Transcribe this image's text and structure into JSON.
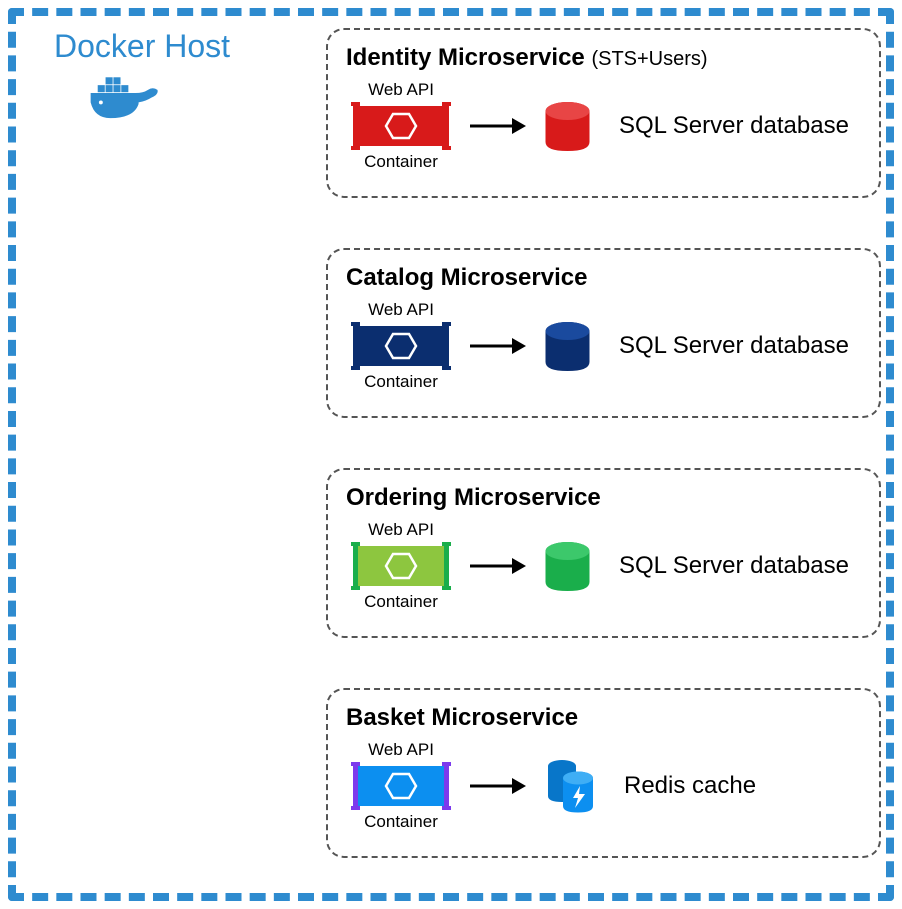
{
  "host_title": "Docker Host",
  "services": [
    {
      "title": "Identity Microservice",
      "subtitle": "(STS+Users)",
      "web_api": "Web API",
      "container": "Container",
      "db_label": "SQL Server database",
      "color_fill": "#d81a1a",
      "color_stroke": "#d81a1a",
      "db_type": "sql"
    },
    {
      "title": "Catalog Microservice",
      "subtitle": "",
      "web_api": "Web API",
      "container": "Container",
      "db_label": "SQL Server database",
      "color_fill": "#0b2e6f",
      "color_stroke": "#0b2e6f",
      "db_type": "sql"
    },
    {
      "title": "Ordering Microservice",
      "subtitle": "",
      "web_api": "Web API",
      "container": "Container",
      "db_label": "SQL Server database",
      "color_fill": "#8dc63f",
      "color_stroke": "#1aae4b",
      "db_fill": "#1aae4b",
      "db_type": "sql"
    },
    {
      "title": "Basket Microservice",
      "subtitle": "",
      "web_api": "Web API",
      "container": "Container",
      "db_label": "Redis cache",
      "color_fill": "#0c8ff0",
      "color_stroke": "#7c3aed",
      "db_fill": "#0c8ff0",
      "db_type": "redis"
    }
  ]
}
